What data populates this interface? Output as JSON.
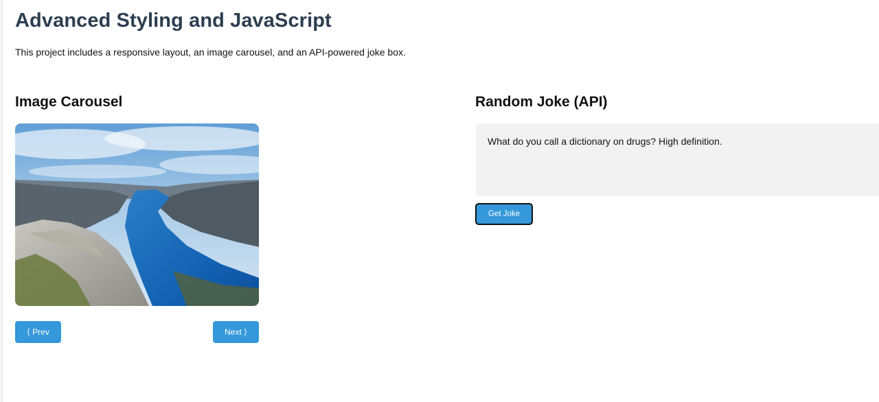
{
  "header": {
    "title": "Advanced Styling and JavaScript",
    "intro": "This project includes a responsive layout, an image carousel, and an API-powered joke box."
  },
  "carousel": {
    "heading": "Image Carousel",
    "prev_label": "⟨ Prev",
    "next_label": "Next ⟩"
  },
  "joke": {
    "heading": "Random Joke (API)",
    "text": "What do you call a dictionary on drugs? High definition.",
    "button_label": "Get Joke"
  },
  "colors": {
    "title": "#2c3e50",
    "button": "#3498db",
    "joke_box_bg": "#f2f2f2"
  }
}
